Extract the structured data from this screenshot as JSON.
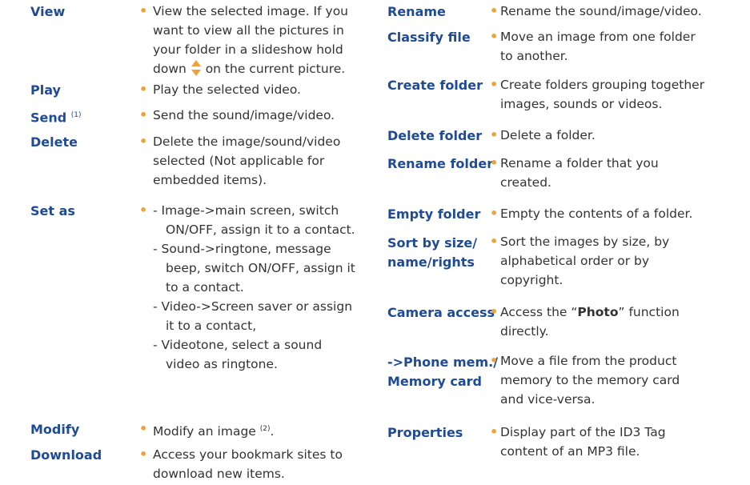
{
  "bullet": "•",
  "accent": "#1f4a96",
  "bullet_color": "#f0a23a",
  "left": [
    {
      "term": "View",
      "lines": [
        "View the selected image. If you",
        "want to view all the pictures in",
        "your folder in a slideshow hold",
        "down",
        "on the current picture."
      ],
      "icon": "up-down-nav-icon"
    },
    {
      "term": "Play",
      "lines": [
        "Play the selected video."
      ]
    },
    {
      "term": "Send",
      "term_sup": "(1)",
      "lines": [
        "Send the sound/image/video."
      ]
    },
    {
      "term": "Delete",
      "lines": [
        "Delete the image/sound/video",
        "selected (Not applicable for",
        "embedded items)."
      ]
    },
    {
      "term": "Set as",
      "lines": [
        "- Image->main screen, switch",
        "ON/OFF, assign it to a contact.",
        "- Sound->ringtone, message",
        "beep, switch ON/OFF, assign it",
        "to a contact.",
        "- Video->Screen saver or assign",
        "it to a contact,",
        "- Videotone, select a sound",
        "video as ringtone."
      ]
    },
    {
      "term": "Modify",
      "lines": [
        "Modify an image"
      ],
      "sup": "(2)",
      "tail": "."
    },
    {
      "term": "Download",
      "lines": [
        "Access your bookmark sites to",
        "download new items."
      ]
    }
  ],
  "right": [
    {
      "term": "Rename",
      "lines": [
        "Rename the sound/image/video."
      ]
    },
    {
      "term": "Classify file",
      "lines": [
        "Move an image from one folder",
        "to another."
      ]
    },
    {
      "term": "Create folder",
      "lines": [
        "Create folders grouping together",
        "images, sounds or videos."
      ]
    },
    {
      "term": "Delete folder",
      "lines": [
        "Delete a folder."
      ]
    },
    {
      "term": "Rename folder",
      "lines": [
        "Rename a folder that you",
        "created."
      ]
    },
    {
      "term": "Empty folder",
      "lines": [
        "Empty the contents of a folder."
      ]
    },
    {
      "term_lines": [
        "Sort by size/",
        "name/rights"
      ],
      "lines": [
        "Sort the images by size, by",
        "alphabetical order or by",
        "copyright."
      ]
    },
    {
      "term": "Camera access",
      "lines": [
        "Access the “",
        "Photo",
        "” function",
        "directly."
      ]
    },
    {
      "term_lines": [
        "->Phone mem./",
        "Memory card"
      ],
      "lines": [
        "Move a file from the product",
        "memory to the memory card",
        "and vice-versa."
      ]
    },
    {
      "term": "Properties",
      "lines": [
        "Display part of the ID3 Tag",
        "content of an MP3 file."
      ]
    }
  ]
}
